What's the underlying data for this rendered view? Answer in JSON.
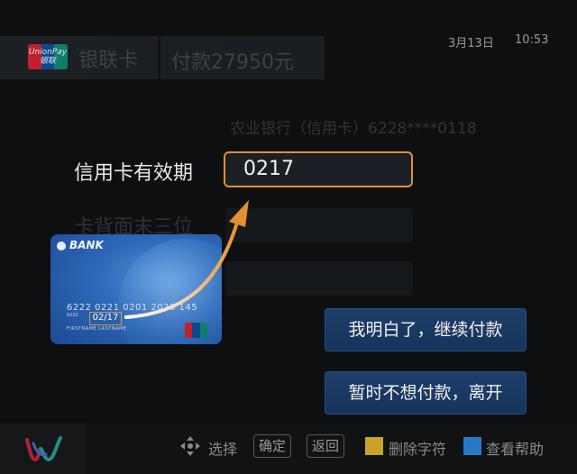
{
  "header": {
    "unionpay_logo_text": "UnionPay 银联",
    "card_type": "银联卡",
    "payment_amount": "付款27950元",
    "date": "3月13日",
    "time": "10:53"
  },
  "account": {
    "bank_account": "农业银行（信用卡）6228****0118"
  },
  "form": {
    "expiry_label": "信用卡有效期",
    "expiry_value": "0217",
    "cvv_label": "卡背面末三位"
  },
  "card_illustration": {
    "bank_name": "BANK",
    "card_number": "6222 0221 0201 2020 145",
    "card_number_small": "6222",
    "expiry": "02/17",
    "holder": "FIRSTNAME LASTNAME"
  },
  "buttons": {
    "continue": "我明白了，继续付款",
    "leave": "暂时不想付款，离开"
  },
  "footer": {
    "select_hint": "选择",
    "confirm_key": "确定",
    "back_key": "返回",
    "delete_char": "删除字符",
    "help": "查看帮助"
  },
  "colors": {
    "accent_orange": "#e3912f",
    "button_blue": "#1d3f6a",
    "yellow_key": "#c9a227",
    "blue_key": "#2a77c7"
  }
}
